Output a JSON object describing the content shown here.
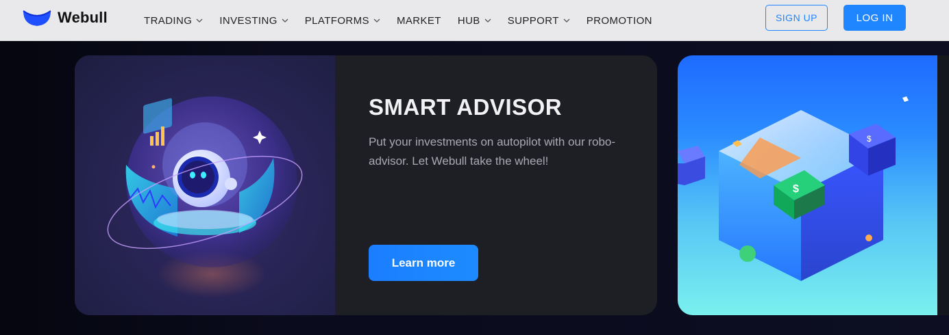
{
  "brand": {
    "name": "Webull",
    "color": "#1f5cff"
  },
  "nav": {
    "items": [
      {
        "label": "TRADING",
        "has_dropdown": true
      },
      {
        "label": "INVESTING",
        "has_dropdown": true
      },
      {
        "label": "PLATFORMS",
        "has_dropdown": true
      },
      {
        "label": "MARKET",
        "has_dropdown": false
      },
      {
        "label": "HUB",
        "has_dropdown": true
      },
      {
        "label": "SUPPORT",
        "has_dropdown": true
      },
      {
        "label": "PROMOTION",
        "has_dropdown": false
      }
    ],
    "sign_up": "SIGN UP",
    "log_in": "LOG IN"
  },
  "slide": {
    "title": "SMART ADVISOR",
    "description": "Put your investments on autopilot with our robo-advisor. Let Webull take the wheel!",
    "cta": "Learn more",
    "art_icon": "robot-advisor-illustration"
  },
  "next_slide": {
    "art_icon": "dollar-cubes-illustration"
  },
  "colors": {
    "accent": "#1f86ff",
    "nav_bg": "#e9e9ec",
    "card_bg": "#1e1f25"
  }
}
